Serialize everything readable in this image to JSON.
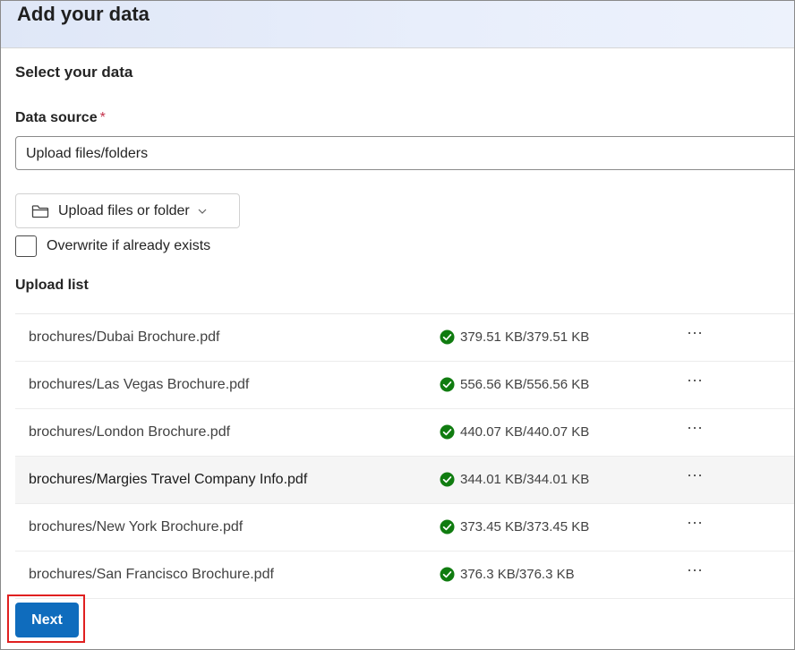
{
  "header": {
    "title": "Add your data"
  },
  "section": {
    "title": "Select your data"
  },
  "data_source": {
    "label": "Data source",
    "required_marker": "*",
    "value": "Upload files/folders"
  },
  "upload_button": {
    "label": "Upload files or folder",
    "icon": "folder-icon"
  },
  "overwrite": {
    "label": "Overwrite if already exists",
    "checked": false
  },
  "upload_list": {
    "title": "Upload list",
    "items": [
      {
        "name": "brochures/Dubai Brochure.pdf",
        "status": "379.51 KB/379.51 KB",
        "more": "···"
      },
      {
        "name": "brochures/Las Vegas Brochure.pdf",
        "status": "556.56 KB/556.56 KB",
        "more": "···"
      },
      {
        "name": "brochures/London Brochure.pdf",
        "status": "440.07 KB/440.07 KB",
        "more": "···"
      },
      {
        "name": "brochures/Margies Travel Company Info.pdf",
        "status": "344.01 KB/344.01 KB",
        "more": "···"
      },
      {
        "name": "brochures/New York Brochure.pdf",
        "status": "373.45 KB/373.45 KB",
        "more": "···"
      },
      {
        "name": "brochures/San Francisco Brochure.pdf",
        "status": "376.3 KB/376.3 KB",
        "more": "···"
      }
    ]
  },
  "next_button": {
    "label": "Next"
  },
  "colors": {
    "accent": "#0f6cbd",
    "success": "#107c10",
    "required": "#c4314b",
    "highlight_border": "#e02020"
  }
}
